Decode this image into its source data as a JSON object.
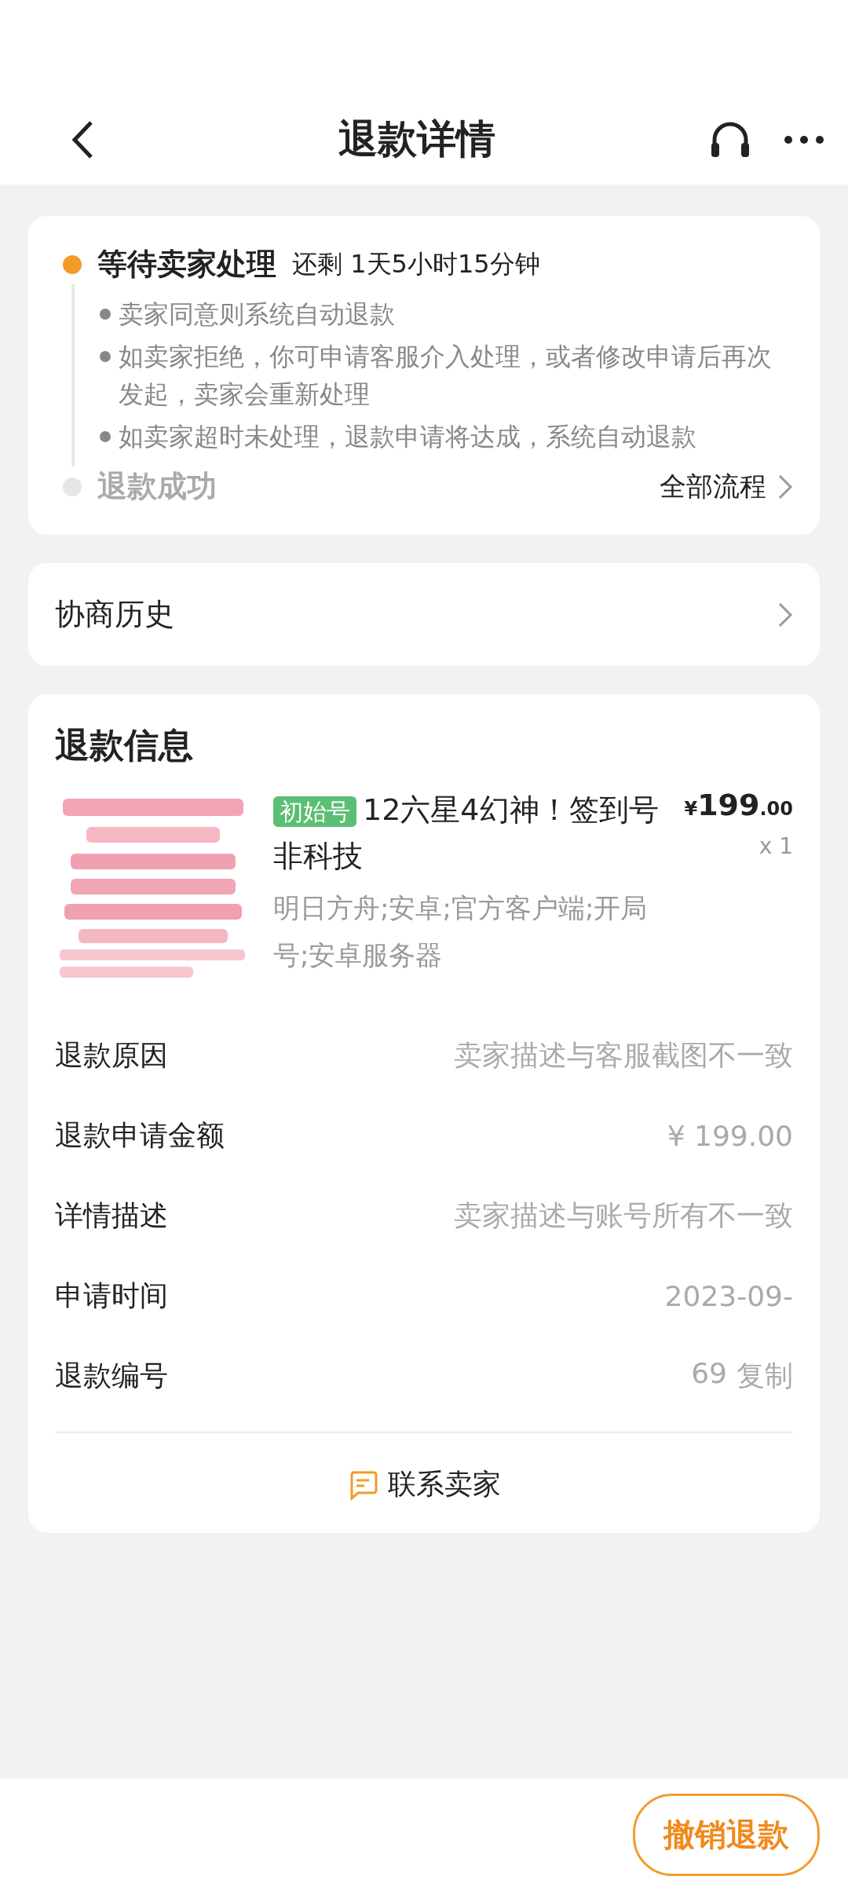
{
  "header": {
    "title": "退款详情"
  },
  "status": {
    "title": "等待卖家处理",
    "countdown": "还剩 1天5小时15分钟",
    "notes": [
      "卖家同意则系统自动退款",
      "如卖家拒绝，你可申请客服介入处理，或者修改申请后再次发起，卖家会重新处理",
      "如卖家超时未处理，退款申请将达成，系统自动退款"
    ],
    "final_step": "退款成功",
    "all_steps_link": "全部流程"
  },
  "history": {
    "label": "协商历史"
  },
  "refund_info": {
    "title": "退款信息",
    "product": {
      "tag": "初始号",
      "name": "12六星4幻神！签到号非科技",
      "specs": "明日方舟;安卓;官方客户端;开局号;安卓服务器",
      "currency": "¥",
      "price_int": "199",
      "price_dec": ".00",
      "quantity": "x 1"
    },
    "rows": [
      {
        "label": "退款原因",
        "value": "卖家描述与客服截图不一致"
      },
      {
        "label": "退款申请金额",
        "value": "¥ 199.00"
      },
      {
        "label": "详情描述",
        "value": "卖家描述与账号所有不一致"
      },
      {
        "label": "申请时间",
        "value": "2023-09-"
      },
      {
        "label": "退款编号",
        "value": "69",
        "action": "复制"
      }
    ],
    "contact": "联系卖家"
  },
  "footer": {
    "button": "撤销退款"
  }
}
